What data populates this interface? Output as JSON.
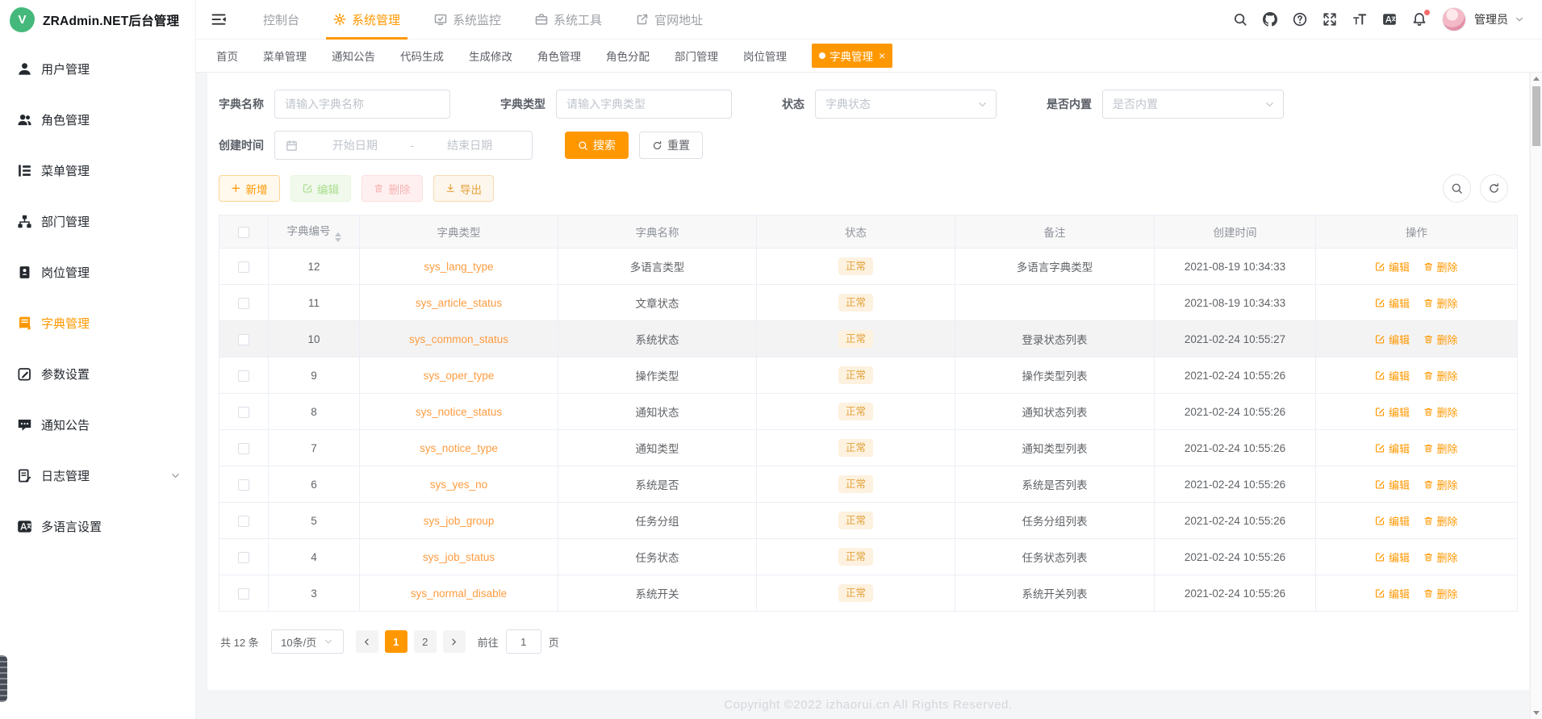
{
  "app": {
    "title": "ZRAdmin.NET后台管理",
    "logo_letter": "V"
  },
  "sidebar": {
    "items": [
      {
        "icon": "user-icon",
        "label": "用户管理",
        "active": false
      },
      {
        "icon": "users-icon",
        "label": "角色管理",
        "active": false
      },
      {
        "icon": "menu-tree-icon",
        "label": "菜单管理",
        "active": false
      },
      {
        "icon": "org-icon",
        "label": "部门管理",
        "active": false
      },
      {
        "icon": "badge-icon",
        "label": "岗位管理",
        "active": false
      },
      {
        "icon": "dict-icon",
        "label": "字典管理",
        "active": true
      },
      {
        "icon": "param-icon",
        "label": "参数设置",
        "active": false
      },
      {
        "icon": "notice-icon",
        "label": "通知公告",
        "active": false
      },
      {
        "icon": "log-icon",
        "label": "日志管理",
        "active": false,
        "has_children": true
      },
      {
        "icon": "lang-icon",
        "label": "多语言设置",
        "active": false
      }
    ]
  },
  "header": {
    "nav": [
      {
        "label": "控制台",
        "icon": null,
        "active": false
      },
      {
        "label": "系统管理",
        "icon": "gear-icon",
        "active": true
      },
      {
        "label": "系统监控",
        "icon": "monitor-icon",
        "active": false
      },
      {
        "label": "系统工具",
        "icon": "toolbox-icon",
        "active": false
      },
      {
        "label": "官网地址",
        "icon": "external-link-icon",
        "active": false
      }
    ],
    "user_name": "管理员"
  },
  "tabs": [
    {
      "label": "首页",
      "active": false
    },
    {
      "label": "菜单管理",
      "active": false
    },
    {
      "label": "通知公告",
      "active": false
    },
    {
      "label": "代码生成",
      "active": false
    },
    {
      "label": "生成修改",
      "active": false
    },
    {
      "label": "角色管理",
      "active": false
    },
    {
      "label": "角色分配",
      "active": false
    },
    {
      "label": "部门管理",
      "active": false
    },
    {
      "label": "岗位管理",
      "active": false
    },
    {
      "label": "字典管理",
      "active": true,
      "closable": true
    }
  ],
  "filters": {
    "dict_name_label": "字典名称",
    "dict_name_placeholder": "请输入字典名称",
    "dict_type_label": "字典类型",
    "dict_type_placeholder": "请输入字典类型",
    "status_label": "状态",
    "status_placeholder": "字典状态",
    "builtin_label": "是否内置",
    "builtin_placeholder": "是否内置",
    "date_label": "创建时间",
    "date_start_placeholder": "开始日期",
    "date_separator": "-",
    "date_end_placeholder": "结束日期",
    "search_label": "搜索",
    "reset_label": "重置"
  },
  "toolbar": {
    "add": "新增",
    "edit": "编辑",
    "delete": "删除",
    "export": "导出"
  },
  "table": {
    "columns": [
      "",
      "字典编号",
      "字典类型",
      "字典名称",
      "状态",
      "备注",
      "创建时间",
      "操作"
    ],
    "edit_label": "编辑",
    "delete_label": "删除",
    "rows": [
      {
        "id": "12",
        "type": "sys_lang_type",
        "name": "多语言类型",
        "status": "正常",
        "remark": "多语言字典类型",
        "created": "2021-08-19 10:34:33"
      },
      {
        "id": "11",
        "type": "sys_article_status",
        "name": "文章状态",
        "status": "正常",
        "remark": "",
        "created": "2021-08-19 10:34:33"
      },
      {
        "id": "10",
        "type": "sys_common_status",
        "name": "系统状态",
        "status": "正常",
        "remark": "登录状态列表",
        "created": "2021-02-24 10:55:27",
        "highlighted": true
      },
      {
        "id": "9",
        "type": "sys_oper_type",
        "name": "操作类型",
        "status": "正常",
        "remark": "操作类型列表",
        "created": "2021-02-24 10:55:26"
      },
      {
        "id": "8",
        "type": "sys_notice_status",
        "name": "通知状态",
        "status": "正常",
        "remark": "通知状态列表",
        "created": "2021-02-24 10:55:26"
      },
      {
        "id": "7",
        "type": "sys_notice_type",
        "name": "通知类型",
        "status": "正常",
        "remark": "通知类型列表",
        "created": "2021-02-24 10:55:26"
      },
      {
        "id": "6",
        "type": "sys_yes_no",
        "name": "系统是否",
        "status": "正常",
        "remark": "系统是否列表",
        "created": "2021-02-24 10:55:26"
      },
      {
        "id": "5",
        "type": "sys_job_group",
        "name": "任务分组",
        "status": "正常",
        "remark": "任务分组列表",
        "created": "2021-02-24 10:55:26"
      },
      {
        "id": "4",
        "type": "sys_job_status",
        "name": "任务状态",
        "status": "正常",
        "remark": "任务状态列表",
        "created": "2021-02-24 10:55:26"
      },
      {
        "id": "3",
        "type": "sys_normal_disable",
        "name": "系统开关",
        "status": "正常",
        "remark": "系统开关列表",
        "created": "2021-02-24 10:55:26"
      }
    ]
  },
  "pagination": {
    "total_text": "共 12 条",
    "page_size": "10条/页",
    "pages": [
      "1",
      "2"
    ],
    "active_page": "1",
    "goto_label": "前往",
    "goto_value": "1",
    "goto_suffix": "页"
  },
  "footer": {
    "copyright": "Copyright ©2022 izhaorui.cn All Rights Reserved."
  },
  "colors": {
    "accent": "#ff9800",
    "link": "#ff9c3f",
    "badge_bg": "#fdf1df",
    "badge_text": "#e2a33d",
    "logo_green": "#45b97c"
  }
}
